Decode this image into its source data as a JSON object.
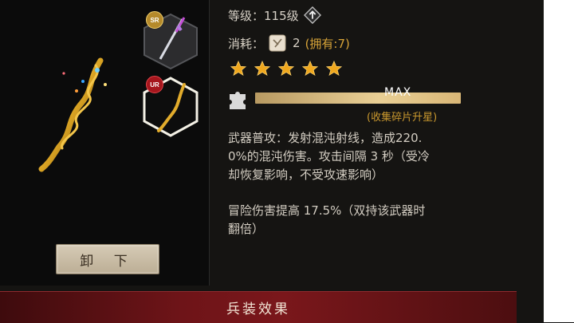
{
  "left": {
    "unequip_label": "卸 下",
    "slot_badges": [
      "SR",
      "UR"
    ]
  },
  "info": {
    "level_label": "等级：",
    "level_value": "115级",
    "cost_label": "消耗：",
    "cost_value": "2",
    "owned_text": "(拥有:7)",
    "stars": 5,
    "star_color": "#f0a81e",
    "progress_label": "MAX",
    "progress_fraction": 1.0,
    "progress_hint": "(收集碎片升星)",
    "description_lines": [
      "武器普攻：发射混沌射线，造成220.",
      "0%的混沌伤害。攻击间隔 3 秒（受冷",
      "却恢复影响，不受攻速影响）"
    ],
    "bonus_lines": [
      "冒险伤害提高 17.5%（双持该武器时",
      "翻倍）"
    ]
  },
  "bottom": {
    "title": "兵装效果"
  },
  "colors": {
    "accent_gold": "#d7a338",
    "bottom_red": "#7a171b"
  }
}
